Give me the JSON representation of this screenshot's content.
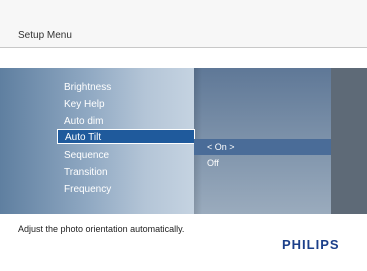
{
  "header": {
    "title": "Setup Menu"
  },
  "menu": {
    "items": [
      {
        "label": "Brightness"
      },
      {
        "label": "Key Help"
      },
      {
        "label": "Auto dim"
      },
      {
        "label": "Auto Tilt",
        "selected": true
      },
      {
        "label": "Sequence"
      },
      {
        "label": "Transition"
      },
      {
        "label": "Frequency"
      }
    ]
  },
  "options": {
    "items": [
      {
        "label": "< On >",
        "selected": true
      },
      {
        "label": "Off"
      }
    ]
  },
  "footer": {
    "description": "Adjust the photo orientation automatically.",
    "brand": "PHILIPS"
  },
  "colors": {
    "selection": "#1f5a9c",
    "brand": "#1b3f8a"
  }
}
